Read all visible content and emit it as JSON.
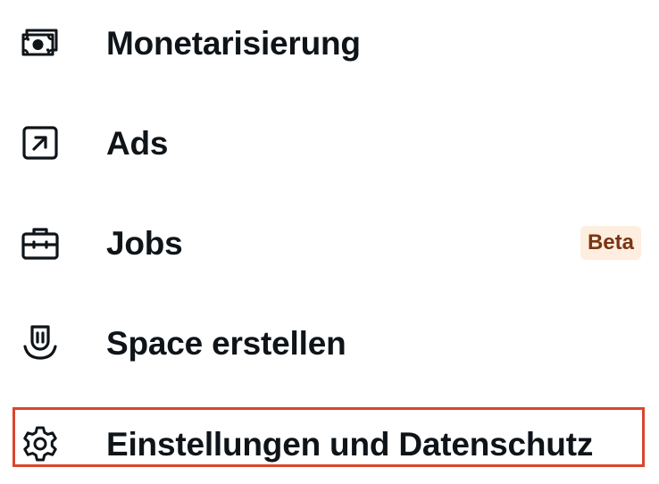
{
  "menu": {
    "items": [
      {
        "label": "Monetarisierung",
        "icon": "money-icon"
      },
      {
        "label": "Ads",
        "icon": "external-arrow-icon"
      },
      {
        "label": "Jobs",
        "icon": "briefcase-icon",
        "badge": "Beta"
      },
      {
        "label": "Space erstellen",
        "icon": "microphone-icon"
      },
      {
        "label": "Einstellungen und Datenschutz",
        "icon": "gear-icon",
        "highlighted": true
      }
    ]
  },
  "colors": {
    "text": "#0f1419",
    "badge_background": "#fdeee0",
    "badge_text": "#7a3413",
    "highlight_border": "#d9462e"
  }
}
